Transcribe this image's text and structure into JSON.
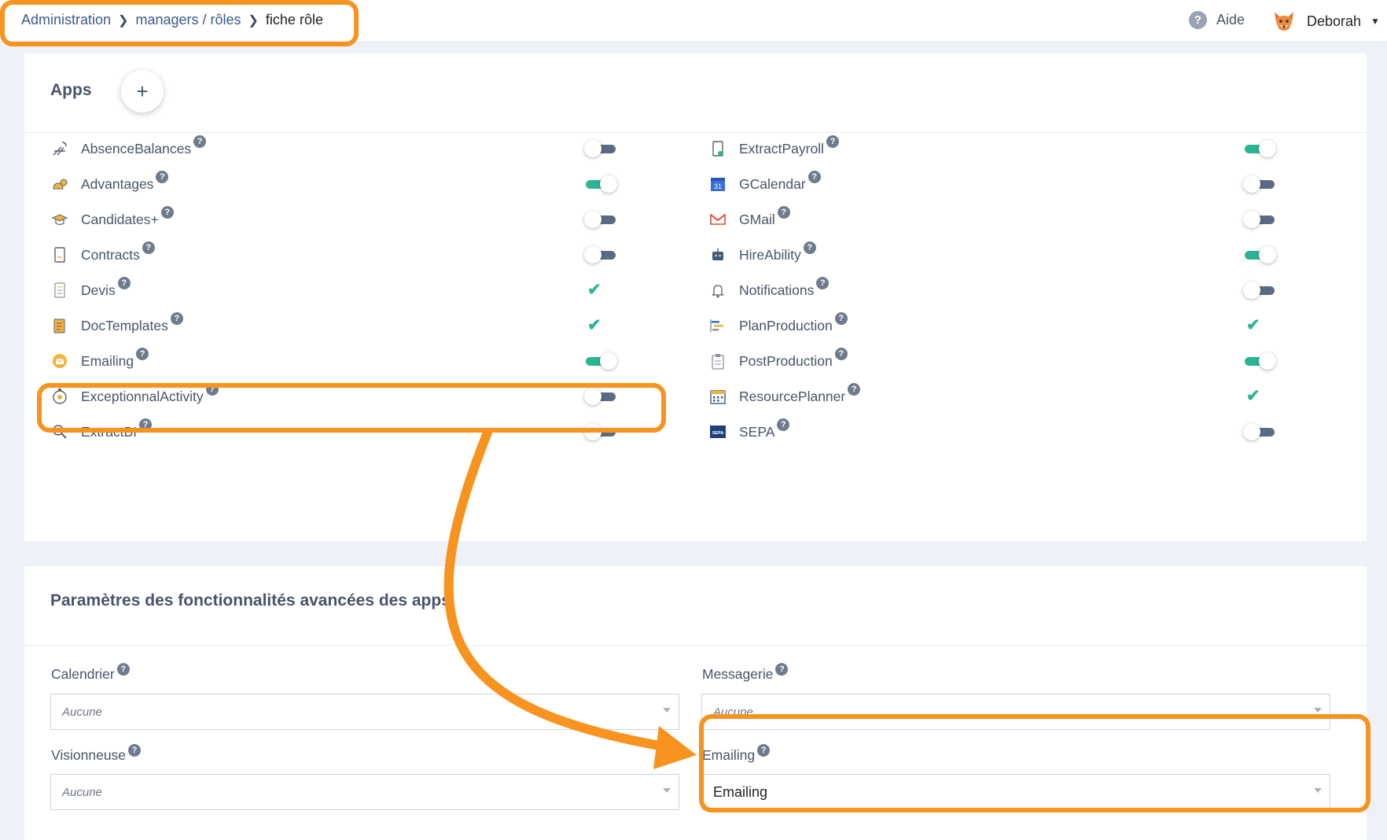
{
  "breadcrumb": {
    "items": [
      "Administration",
      "managers / rôles",
      "fiche rôle"
    ]
  },
  "header": {
    "help_label": "Aide",
    "user_name": "Deborah"
  },
  "apps_card": {
    "title": "Apps",
    "add_label": "+",
    "left_apps": [
      {
        "name": "AbsenceBalances",
        "state": "off",
        "icon": "beach-chair-icon"
      },
      {
        "name": "Advantages",
        "state": "on",
        "icon": "coin-bag-icon"
      },
      {
        "name": "Candidates+",
        "state": "off",
        "icon": "graduation-cap-icon"
      },
      {
        "name": "Contracts",
        "state": "off",
        "icon": "contract-document-icon"
      },
      {
        "name": "Devis",
        "state": "check",
        "icon": "quote-document-icon"
      },
      {
        "name": "DocTemplates",
        "state": "check",
        "icon": "doc-templates-icon"
      },
      {
        "name": "Emailing",
        "state": "on",
        "icon": "email-circle-icon"
      },
      {
        "name": "ExceptionnalActivity",
        "state": "off",
        "icon": "stopwatch-icon"
      },
      {
        "name": "ExtractBI",
        "state": "off",
        "icon": "magnifier-icon"
      }
    ],
    "right_apps": [
      {
        "name": "ExtractPayroll",
        "state": "on",
        "icon": "payroll-document-icon"
      },
      {
        "name": "GCalendar",
        "state": "off",
        "icon": "google-calendar-icon",
        "icon_text": "31"
      },
      {
        "name": "GMail",
        "state": "off",
        "icon": "gmail-icon"
      },
      {
        "name": "HireAbility",
        "state": "on",
        "icon": "robot-icon"
      },
      {
        "name": "Notifications",
        "state": "off",
        "icon": "bell-icon"
      },
      {
        "name": "PlanProduction",
        "state": "check",
        "icon": "gantt-chart-icon"
      },
      {
        "name": "PostProduction",
        "state": "on",
        "icon": "clipboard-icon"
      },
      {
        "name": "ResourcePlanner",
        "state": "check",
        "icon": "calendar-grid-icon"
      },
      {
        "name": "SEPA",
        "state": "off",
        "icon": "sepa-logo-icon",
        "icon_text": "SEPA"
      }
    ]
  },
  "params_card": {
    "title": "Paramètres des fonctionnalités avancées des apps",
    "fields": [
      {
        "label": "Calendrier",
        "value": "Aucune"
      },
      {
        "label": "Messagerie",
        "value": "Aucune"
      },
      {
        "label": "Visionneuse",
        "value": "Aucune"
      },
      {
        "label": "Emailing",
        "value": "Emailing"
      }
    ]
  },
  "colors": {
    "accent_toggle": "#2bb594",
    "highlight": "#f7931e",
    "toggle_off": "#5b6b84"
  }
}
